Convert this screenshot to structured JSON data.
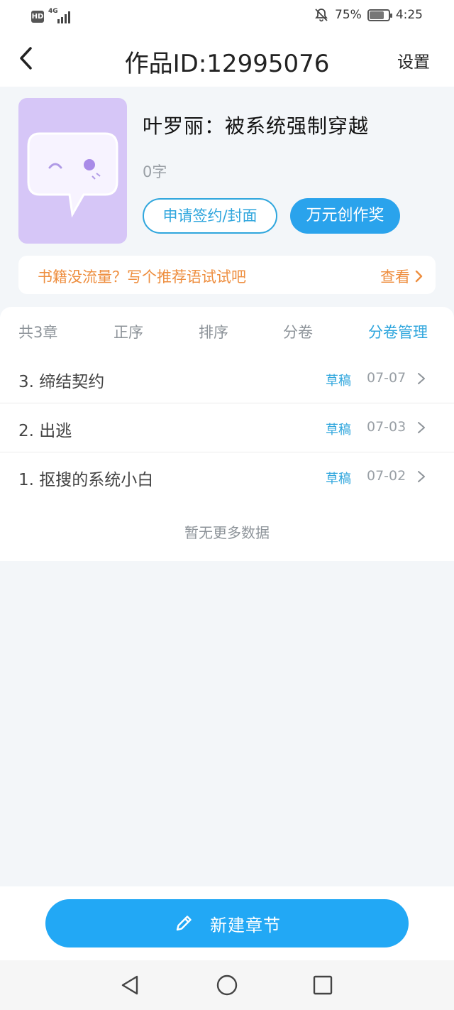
{
  "status_bar": {
    "hd_badge": "HD",
    "network": "4G",
    "battery_percent": "75%",
    "battery_level": 0.75,
    "time": "4:25",
    "icons": [
      "hd-icon",
      "signal-icon",
      "mute-bell-icon",
      "battery-icon"
    ]
  },
  "header": {
    "back_icon": "chevron-left-icon",
    "title": "作品ID:12995076",
    "settings_label": "设置"
  },
  "book": {
    "title": "叶罗丽：被系统强制穿越",
    "word_count": "0字",
    "sign_button_label": "申请签约/封面",
    "award_button_label": "万元创作奖",
    "cover_colors": {
      "background": "#d6c6f7",
      "bubble": "#ffffff",
      "accent": "#a98be8"
    }
  },
  "promo": {
    "text": "书籍没流量？写个推荐语试试吧",
    "link_label": "查看",
    "color": "#ee8e3f"
  },
  "chapter_toolbar": {
    "count_label": "共3章",
    "order_label": "正序",
    "sort_label": "排序",
    "volume_label": "分卷",
    "volume_manage_label": "分卷管理"
  },
  "chapters": [
    {
      "name": "3. 缔结契约",
      "status": "草稿",
      "date": "07-07"
    },
    {
      "name": "2. 出逃",
      "status": "草稿",
      "date": "07-03"
    },
    {
      "name": "1. 抠搜的系统小白",
      "status": "草稿",
      "date": "07-02"
    }
  ],
  "list_footer": "暂无更多数据",
  "new_chapter_button": {
    "label": "新建章节",
    "icon": "pencil-icon"
  },
  "nav": {
    "icons": [
      "nav-back-icon",
      "nav-home-icon",
      "nav-recents-icon"
    ]
  },
  "colors": {
    "accent_blue": "#2fa6dd",
    "primary_button": "#22a8f5",
    "page_background": "#f3f6f9",
    "promo_orange": "#ee8e3f"
  }
}
